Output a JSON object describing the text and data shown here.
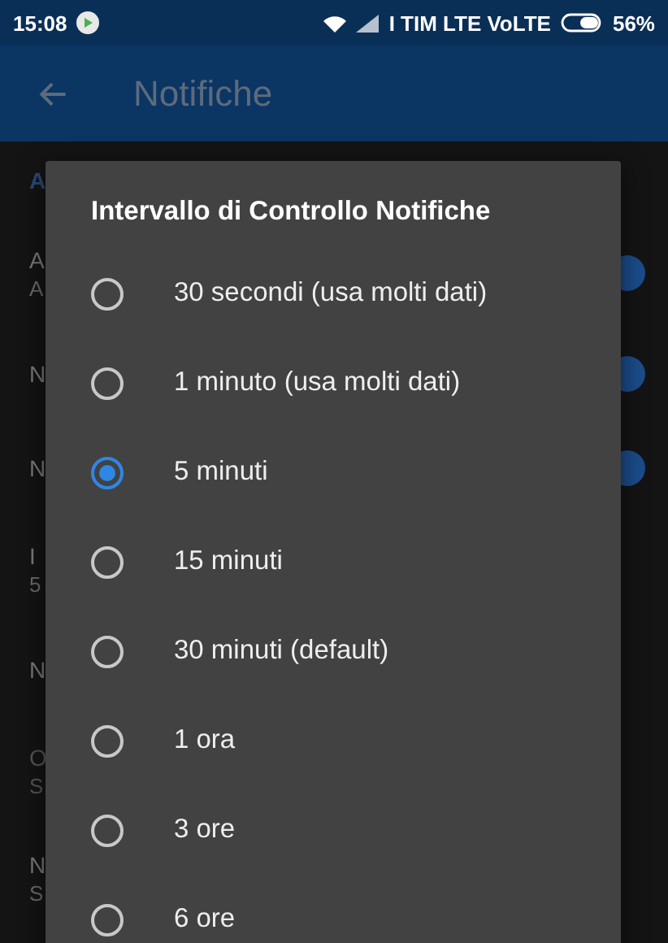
{
  "status_bar": {
    "time": "15:08",
    "carrier": "I TIM LTE VoLTE",
    "battery": "56%"
  },
  "toolbar": {
    "title": "Notifiche"
  },
  "settings": {
    "header": "A",
    "items": [
      {
        "label": "A",
        "summary": "A",
        "toggle_on": true
      },
      {
        "label": "N",
        "toggle_on": true
      },
      {
        "label": "N",
        "toggle_on": true
      },
      {
        "label": "I",
        "summary": "5"
      },
      {
        "label": "N"
      },
      {
        "label": "O",
        "summary": "S",
        "disabled": true
      },
      {
        "label": "N",
        "summary": "S"
      }
    ]
  },
  "dialog": {
    "title": "Intervallo di Controllo Notifiche",
    "options": [
      {
        "label": "30 secondi (usa molti dati)",
        "selected": false
      },
      {
        "label": "1 minuto (usa molti dati)",
        "selected": false
      },
      {
        "label": "5 minuti",
        "selected": true
      },
      {
        "label": "15 minuti",
        "selected": false
      },
      {
        "label": "30 minuti (default)",
        "selected": false
      },
      {
        "label": "1 ora",
        "selected": false
      },
      {
        "label": "3 ore",
        "selected": false
      },
      {
        "label": "6 ore",
        "selected": false
      }
    ]
  }
}
